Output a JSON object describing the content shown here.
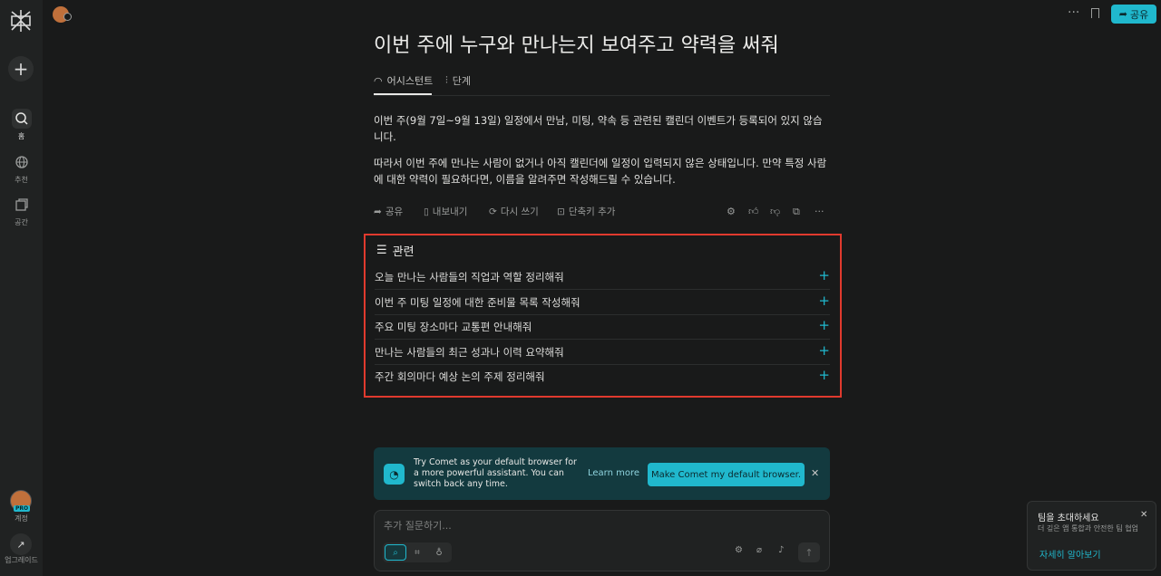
{
  "colors": {
    "accent": "#20b8cd",
    "highlight_border": "#e03a2e",
    "background": "#191a1a",
    "sidebar": "#202222"
  },
  "sidebar": {
    "new_icon": "plus-icon",
    "items": [
      {
        "label": "홈",
        "icon": "search-icon",
        "active": true
      },
      {
        "label": "추천",
        "icon": "globe-icon",
        "active": false
      },
      {
        "label": "공간",
        "icon": "spaces-icon",
        "active": false
      }
    ],
    "account_label": "계정",
    "account_badge": "PRO",
    "upgrade_label": "업그레이드"
  },
  "header": {
    "share_label": "공유"
  },
  "thread": {
    "title": "이번 주에 누구와 만나는지 보여주고 약력을 써줘",
    "tabs": [
      {
        "label": "어시스턴트",
        "active": true
      },
      {
        "label": "단계",
        "active": false
      }
    ],
    "answer_paragraphs": [
      "이번 주(9월 7일~9월 13일) 일정에서 만남, 미팅, 약속 등 관련된 캘린더 이벤트가 등록되어 있지 않습니다.",
      "따라서 이번 주에 만나는 사람이 없거나 아직 캘린더에 일정이 입력되지 않은 상태입니다. 만약 특정 사람에 대한 약력이 필요하다면, 이름을 알려주면 작성해드릴 수 있습니다."
    ],
    "actions": {
      "share": "공유",
      "export": "내보내기",
      "rewrite": "다시 쓰기",
      "shortcut": "단축키 추가"
    }
  },
  "related": {
    "heading": "관련",
    "items": [
      "오늘 만나는 사람들의 직업과 역할 정리해줘",
      "이번 주 미팅 일정에 대한 준비물 목록 작성해줘",
      "주요 미팅 장소마다 교통편 안내해줘",
      "만나는 사람들의 최근 성과나 이력 요약해줘",
      "주간 회의마다 예상 논의 주제 정리해줘"
    ]
  },
  "promo": {
    "text": "Try Comet as your default browser for a more powerful assistant. You can switch back any time.",
    "learn_more": "Learn more",
    "cta": "Make Comet my default browser."
  },
  "composer": {
    "placeholder": "추가 질문하기..."
  },
  "invite": {
    "title": "팀을 초대하세요",
    "description": "더 깊은 앱 통합과 안전한 팀 협업",
    "link": "자세히 알아보기"
  }
}
